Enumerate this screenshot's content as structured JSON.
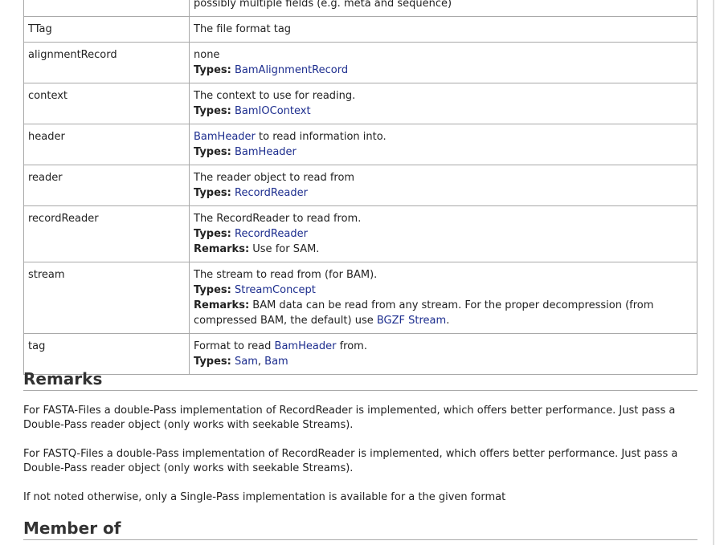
{
  "params": {
    "rows": [
      {
        "name": "",
        "lines": [
          [
            {
              "t": "possibly multiple fields (e.g. meta and sequence)",
              "link": false
            }
          ]
        ]
      },
      {
        "name": "TTag",
        "lines": [
          [
            {
              "t": "The file format tag",
              "link": false
            }
          ]
        ]
      },
      {
        "name": "alignmentRecord",
        "lines": [
          [
            {
              "t": "none",
              "link": false
            }
          ],
          [
            {
              "t": "Types:",
              "label": true
            },
            {
              "t": " ",
              "link": false
            },
            {
              "t": "BamAlignmentRecord",
              "link": true
            }
          ]
        ]
      },
      {
        "name": "context",
        "lines": [
          [
            {
              "t": "The context to use for reading.",
              "link": false
            }
          ],
          [
            {
              "t": "Types:",
              "label": true
            },
            {
              "t": " ",
              "link": false
            },
            {
              "t": "BamIOContext",
              "link": true
            }
          ]
        ]
      },
      {
        "name": "header",
        "lines": [
          [
            {
              "t": "BamHeader",
              "link": true
            },
            {
              "t": " to read information into.",
              "link": false
            }
          ],
          [
            {
              "t": "Types:",
              "label": true
            },
            {
              "t": " ",
              "link": false
            },
            {
              "t": "BamHeader",
              "link": true
            }
          ]
        ]
      },
      {
        "name": "reader",
        "lines": [
          [
            {
              "t": "The reader object to read from",
              "link": false
            }
          ],
          [
            {
              "t": "Types:",
              "label": true
            },
            {
              "t": " ",
              "link": false
            },
            {
              "t": "RecordReader",
              "link": true
            }
          ]
        ]
      },
      {
        "name": "recordReader",
        "lines": [
          [
            {
              "t": "The RecordReader to read from.",
              "link": false
            }
          ],
          [
            {
              "t": "Types:",
              "label": true
            },
            {
              "t": " ",
              "link": false
            },
            {
              "t": "RecordReader",
              "link": true
            }
          ],
          [
            {
              "t": "Remarks:",
              "label": true
            },
            {
              "t": " Use for SAM.",
              "link": false
            }
          ]
        ]
      },
      {
        "name": "stream",
        "lines": [
          [
            {
              "t": "The stream to read from (for BAM).",
              "link": false
            }
          ],
          [
            {
              "t": "Types:",
              "label": true
            },
            {
              "t": " ",
              "link": false
            },
            {
              "t": "StreamConcept",
              "link": true
            }
          ],
          [
            {
              "t": "Remarks:",
              "label": true
            },
            {
              "t": " BAM data can be read from any stream. For the proper decompression (from compressed BAM, the default) use ",
              "link": false
            },
            {
              "t": "BGZF Stream",
              "link": true
            },
            {
              "t": ".",
              "link": false
            }
          ]
        ]
      },
      {
        "name": "tag",
        "lines": [
          [
            {
              "t": "Format to read ",
              "link": false
            },
            {
              "t": "BamHeader",
              "link": true
            },
            {
              "t": " from.",
              "link": false
            }
          ],
          [
            {
              "t": "Types:",
              "label": true
            },
            {
              "t": " ",
              "link": false
            },
            {
              "t": "Sam",
              "link": true
            },
            {
              "t": ", ",
              "link": false
            },
            {
              "t": "Bam",
              "link": true
            }
          ]
        ]
      }
    ]
  },
  "remarks": {
    "heading": "Remarks",
    "paragraphs": [
      "For FASTA-Files a double-Pass implementation of RecordReader is implemented, which offers better performance. Just pass a Double-Pass reader object (only works with seekable Streams).",
      "For FASTQ-Files a double-Pass implementation of RecordReader is implemented, which offers better performance. Just pass a Double-Pass reader object (only works with seekable Streams).",
      "If not noted otherwise, only a Single-Pass implementation is available for a the given format"
    ]
  },
  "member_of": {
    "heading": "Member of"
  },
  "colors": {
    "link": "#1c2d8e",
    "border": "#a9a9a9",
    "text": "#222222"
  }
}
